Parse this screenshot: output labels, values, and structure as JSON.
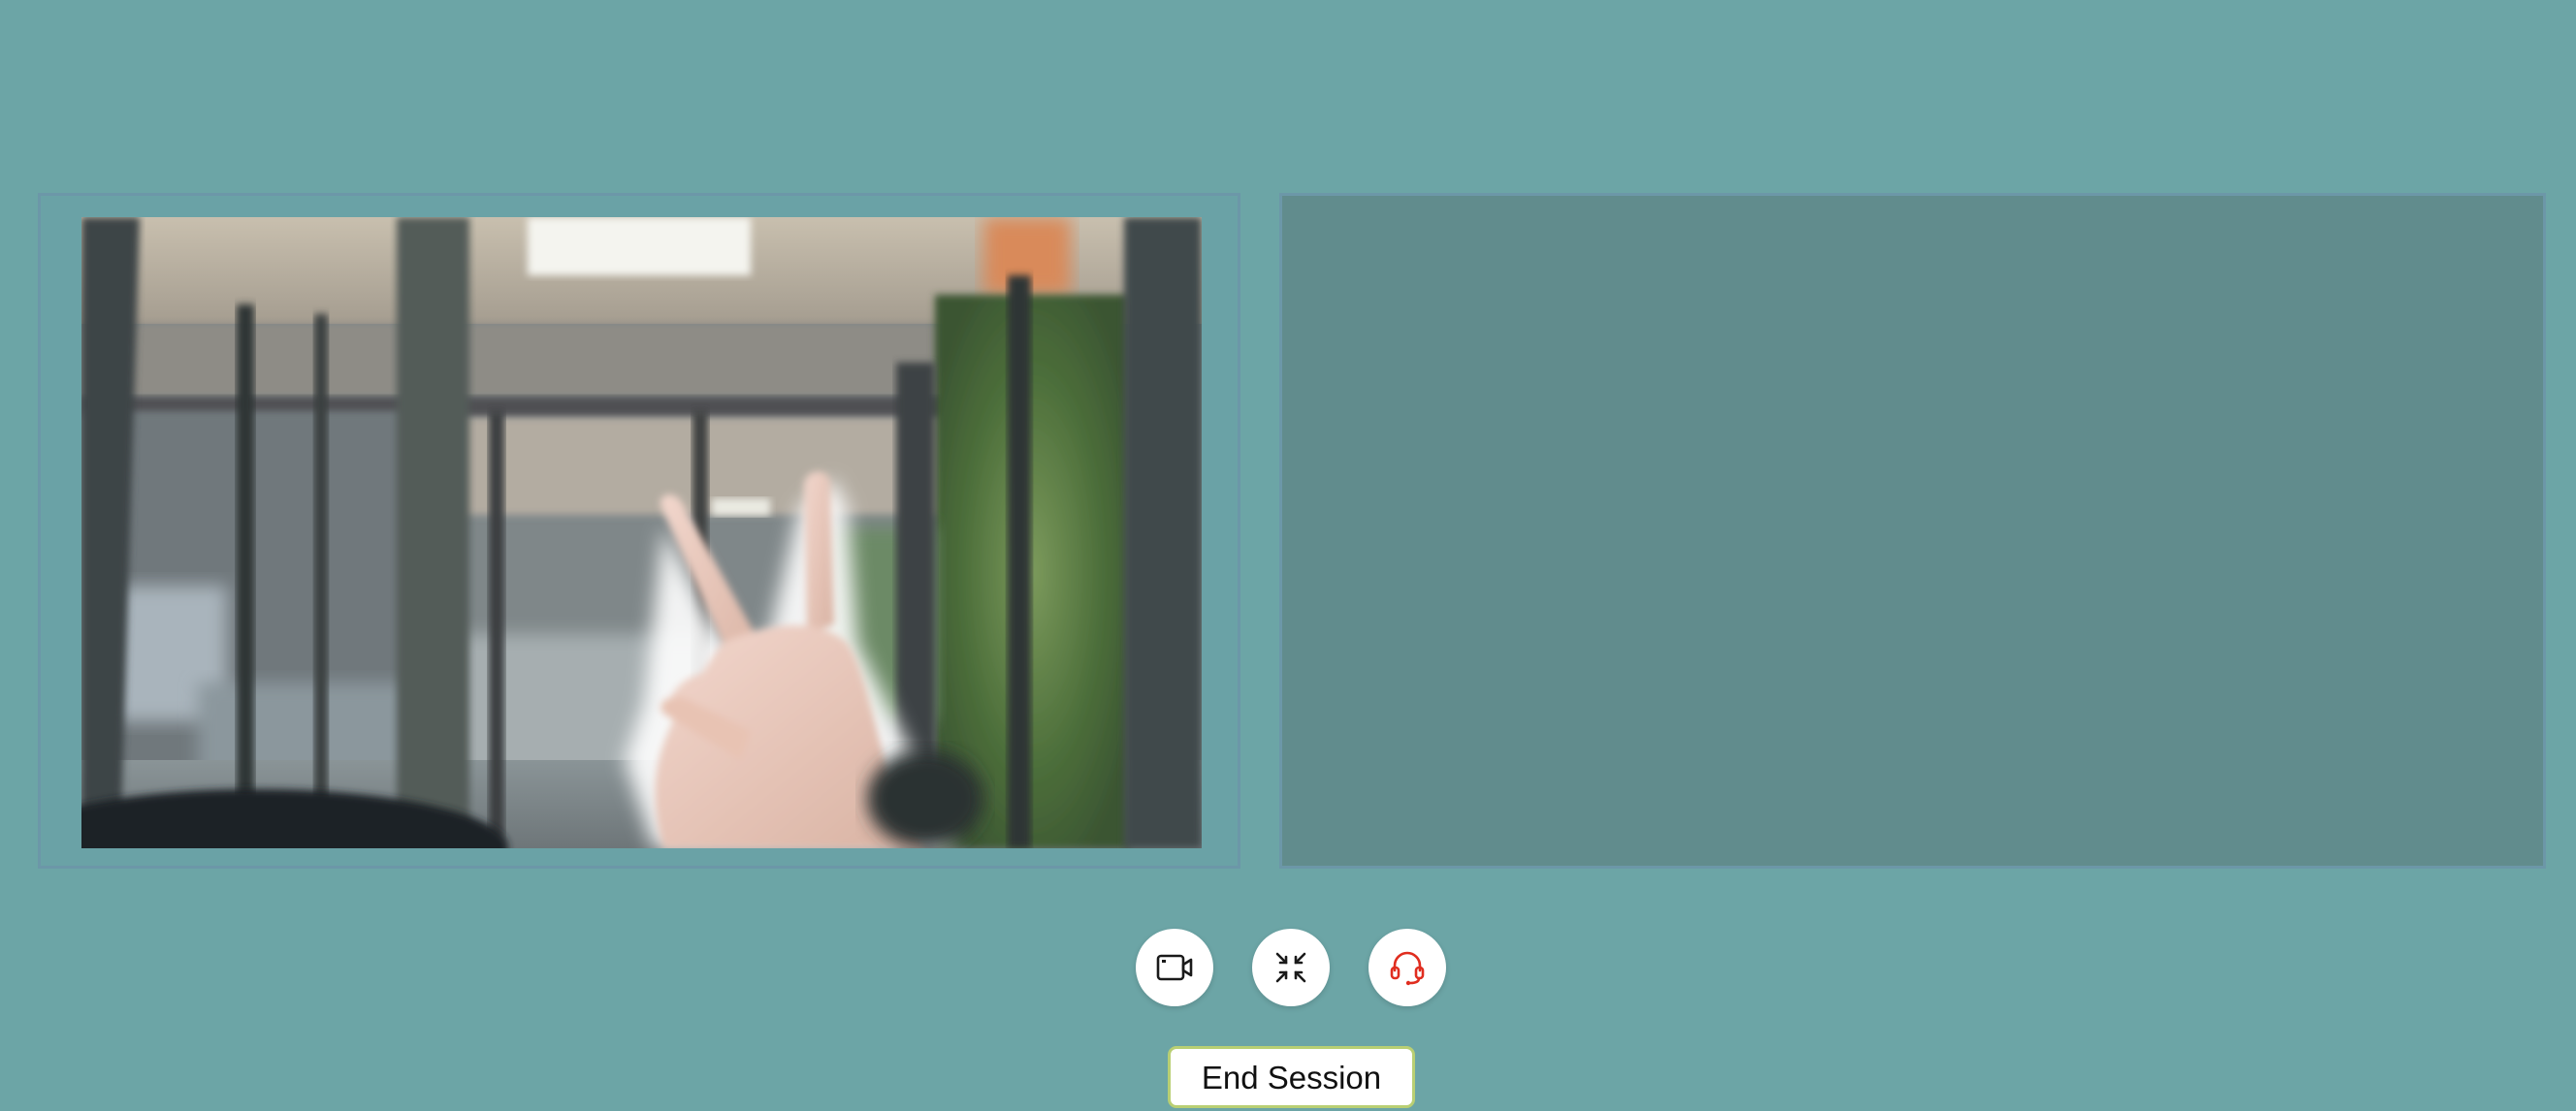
{
  "session": {
    "end_button_label": "End Session"
  },
  "controls": [
    {
      "icon": "video-camera-icon"
    },
    {
      "icon": "minimize-arrows-icon"
    },
    {
      "icon": "headset-icon",
      "color": "#e02d1f"
    }
  ],
  "colors": {
    "background": "#6ca5a6",
    "local_tile": "#6aa2a6",
    "remote_tile": "#618c8d",
    "tile_border": "#6c97a8",
    "end_button_border": "#b9cf73",
    "support_icon": "#e02d1f"
  }
}
